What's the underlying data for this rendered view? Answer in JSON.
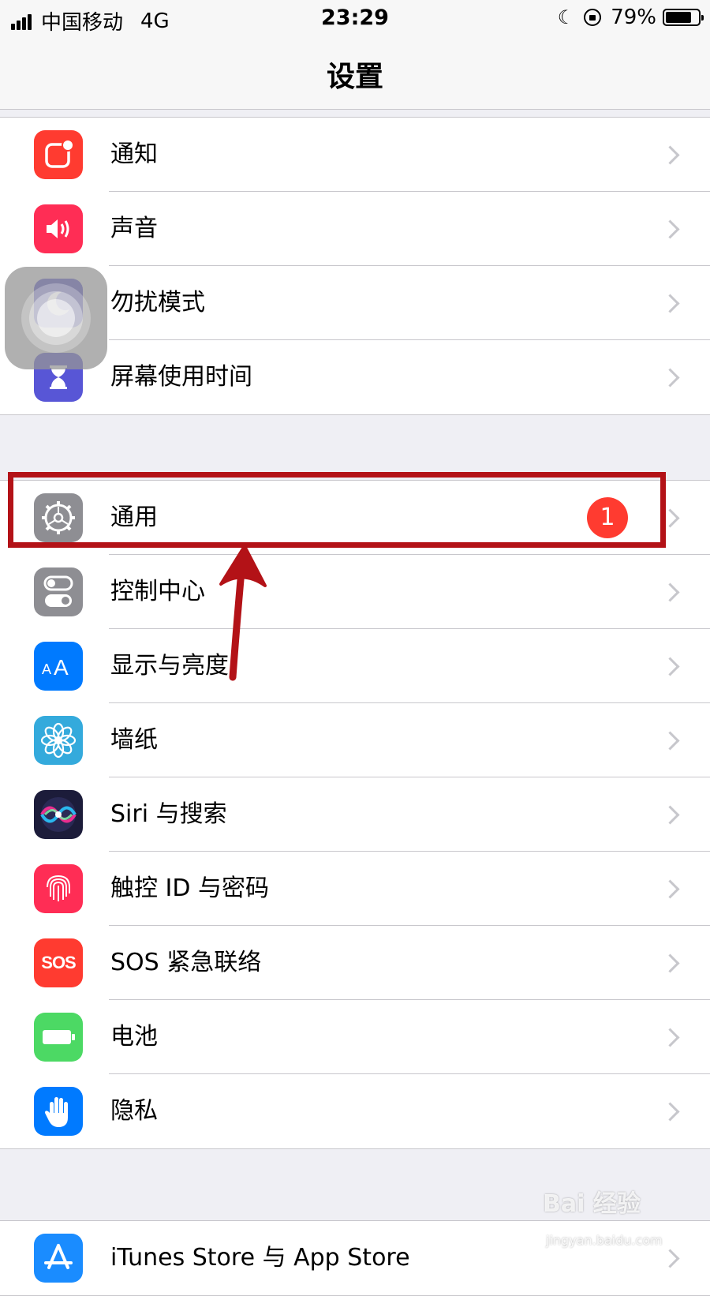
{
  "status_bar": {
    "carrier": "中国移动",
    "network": "4G",
    "time": "23:29",
    "battery": "79%",
    "battery_level": 0.79
  },
  "nav": {
    "title": "设置"
  },
  "groups": [
    {
      "items": [
        {
          "label": "通知",
          "icon": "notifications-icon",
          "color": "#ff3b30"
        },
        {
          "label": "声音",
          "icon": "speaker-icon",
          "color": "#ff2d55"
        },
        {
          "label": "勿扰模式",
          "icon": "moon-icon",
          "color": "#5856d6"
        },
        {
          "label": "屏幕使用时间",
          "icon": "hourglass-icon",
          "color": "#5856d6"
        }
      ]
    },
    {
      "items": [
        {
          "label": "通用",
          "icon": "gear-icon",
          "color": "#8e8e93",
          "badge": "1"
        },
        {
          "label": "控制中心",
          "icon": "toggles-icon",
          "color": "#8e8e93"
        },
        {
          "label": "显示与亮度",
          "icon": "text-size-icon",
          "color": "#007aff"
        },
        {
          "label": "墙纸",
          "icon": "flower-icon",
          "color": "#34aadc"
        },
        {
          "label": "Siri 与搜索",
          "icon": "siri-icon",
          "color": "#1c1c3a"
        },
        {
          "label": "触控 ID 与密码",
          "icon": "fingerprint-icon",
          "color": "#ff2d55"
        },
        {
          "label": "SOS 紧急联络",
          "icon": "sos-icon",
          "color": "#ff3b30",
          "icon_text": "SOS"
        },
        {
          "label": "电池",
          "icon": "battery-icon",
          "color": "#4cd964"
        },
        {
          "label": "隐私",
          "icon": "hand-icon",
          "color": "#007aff"
        }
      ]
    },
    {
      "items": [
        {
          "label": "iTunes Store 与 App Store",
          "icon": "app-store-icon",
          "color": "#1a8cff"
        }
      ]
    }
  ],
  "watermark": {
    "text": "Bai 经验",
    "sub": "jingyan.baidu.com"
  }
}
